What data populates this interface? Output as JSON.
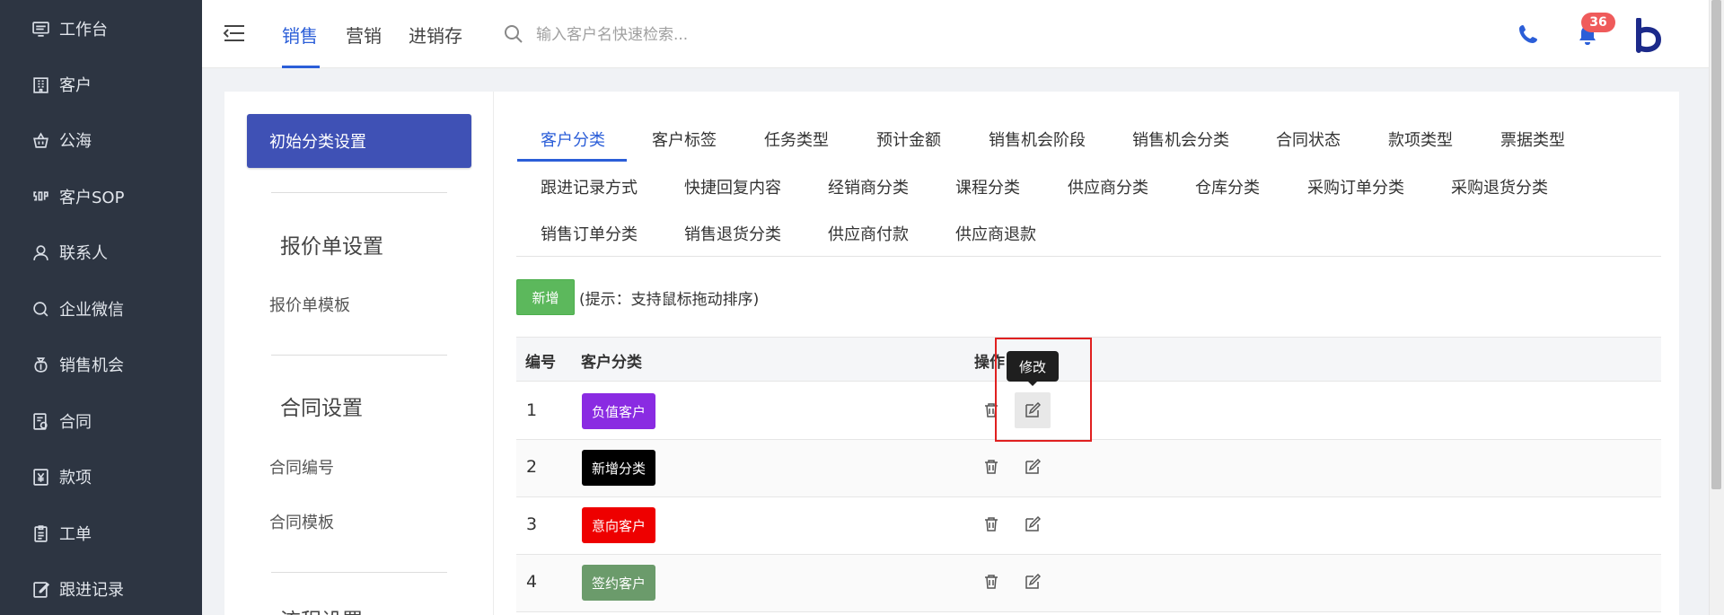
{
  "sidebar": {
    "items": [
      {
        "label": "工作台",
        "icon": "monitor-icon"
      },
      {
        "label": "客户",
        "icon": "building-icon"
      },
      {
        "label": "公海",
        "icon": "basket-icon"
      },
      {
        "label": "客户SOP",
        "icon": "sop-icon"
      },
      {
        "label": "联系人",
        "icon": "user-icon"
      },
      {
        "label": "企业微信",
        "icon": "chat-bubble-icon"
      },
      {
        "label": "销售机会",
        "icon": "money-bag-icon"
      },
      {
        "label": "合同",
        "icon": "contract-icon"
      },
      {
        "label": "款项",
        "icon": "yen-icon"
      },
      {
        "label": "工单",
        "icon": "clipboard-icon"
      },
      {
        "label": "跟进记录",
        "icon": "edit-note-icon"
      }
    ]
  },
  "header": {
    "tabs": [
      {
        "label": "销售",
        "active": true
      },
      {
        "label": "营销",
        "active": false
      },
      {
        "label": "进销存",
        "active": false
      }
    ],
    "search_placeholder": "输入客户名快速检索...",
    "notification_count": "36",
    "accent_color": "#2b5ed8"
  },
  "left_menu": {
    "active_item": "初始分类设置",
    "sections": [
      {
        "heading": "报价单设置",
        "links": [
          "报价单模板"
        ]
      },
      {
        "heading": "合同设置",
        "links": [
          "合同编号",
          "合同模板"
        ]
      },
      {
        "heading": "流程设置",
        "links": []
      }
    ]
  },
  "category_tabs": [
    {
      "label": "客户分类",
      "active": true
    },
    {
      "label": "客户标签"
    },
    {
      "label": "任务类型"
    },
    {
      "label": "预计金额"
    },
    {
      "label": "销售机会阶段"
    },
    {
      "label": "销售机会分类"
    },
    {
      "label": "合同状态"
    },
    {
      "label": "款项类型"
    },
    {
      "label": "票据类型"
    },
    {
      "label": "跟进记录方式"
    },
    {
      "label": "快捷回复内容"
    },
    {
      "label": "经销商分类"
    },
    {
      "label": "课程分类"
    },
    {
      "label": "供应商分类"
    },
    {
      "label": "仓库分类"
    },
    {
      "label": "采购订单分类"
    },
    {
      "label": "采购退货分类"
    },
    {
      "label": "销售订单分类"
    },
    {
      "label": "销售退货分类"
    },
    {
      "label": "供应商付款"
    },
    {
      "label": "供应商退款"
    }
  ],
  "toolbar": {
    "add_label": "新增",
    "hint": "(提示：支持鼠标拖动排序)"
  },
  "table": {
    "columns": [
      "编号",
      "客户分类",
      "操作"
    ],
    "rows": [
      {
        "num": "1",
        "tag": "负值客户",
        "color": "#8a2be2"
      },
      {
        "num": "2",
        "tag": "新增分类",
        "color": "#000000"
      },
      {
        "num": "3",
        "tag": "意向客户",
        "color": "#ee0000"
      },
      {
        "num": "4",
        "tag": "签约客户",
        "color": "#6b9b6b"
      }
    ]
  },
  "tooltip": {
    "label": "修改"
  }
}
